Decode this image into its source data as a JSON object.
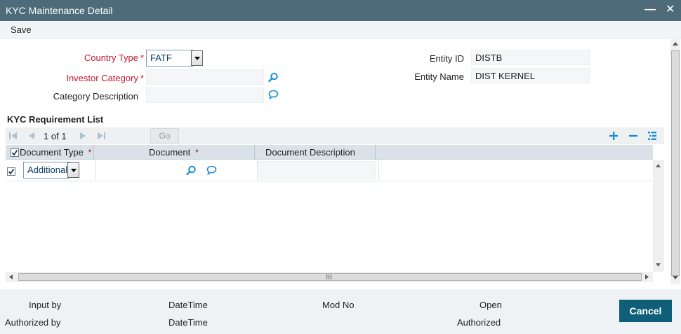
{
  "window": {
    "title": "KYC Maintenance Detail",
    "minimize_glyph": "—",
    "close_glyph": "✕"
  },
  "menu": {
    "save_label": "Save"
  },
  "form": {
    "country_type": {
      "label": "Country Type",
      "required": "*",
      "value": "FATF"
    },
    "investor_category": {
      "label": "Investor Category",
      "required": "*",
      "value": ""
    },
    "category_description": {
      "label": "Category Description",
      "value": ""
    },
    "entity_id": {
      "label": "Entity ID",
      "value": "DISTB"
    },
    "entity_name": {
      "label": "Entity Name",
      "value": "DIST KERNEL"
    }
  },
  "kyc_list": {
    "title": "KYC Requirement List",
    "pager": {
      "current": "1",
      "of_label": "of",
      "total": "1",
      "go_label": "Go"
    },
    "toolbar_icons": [
      "add-row-icon",
      "delete-row-icon",
      "single-view-icon"
    ],
    "columns": [
      {
        "label": "Document Type",
        "required": "*"
      },
      {
        "label": "Document",
        "required": "*"
      },
      {
        "label": "Document Description",
        "required": ""
      }
    ],
    "header_checkbox": true,
    "rows": [
      {
        "checked": true,
        "document_type": "Additional",
        "document": "",
        "document_description": ""
      }
    ]
  },
  "footer": {
    "input_by": "Input by",
    "authorized_by": "Authorized by",
    "datetime_1": "DateTime",
    "datetime_2": "DateTime",
    "mod_no": "Mod No",
    "open": "Open",
    "authorized": "Authorized",
    "cancel_label": "Cancel"
  },
  "colors": {
    "titlebar": "#4d6b78",
    "required": "#c0182b",
    "accent_icon": "#1a8fd6",
    "cancel_button": "#0e5f77"
  }
}
